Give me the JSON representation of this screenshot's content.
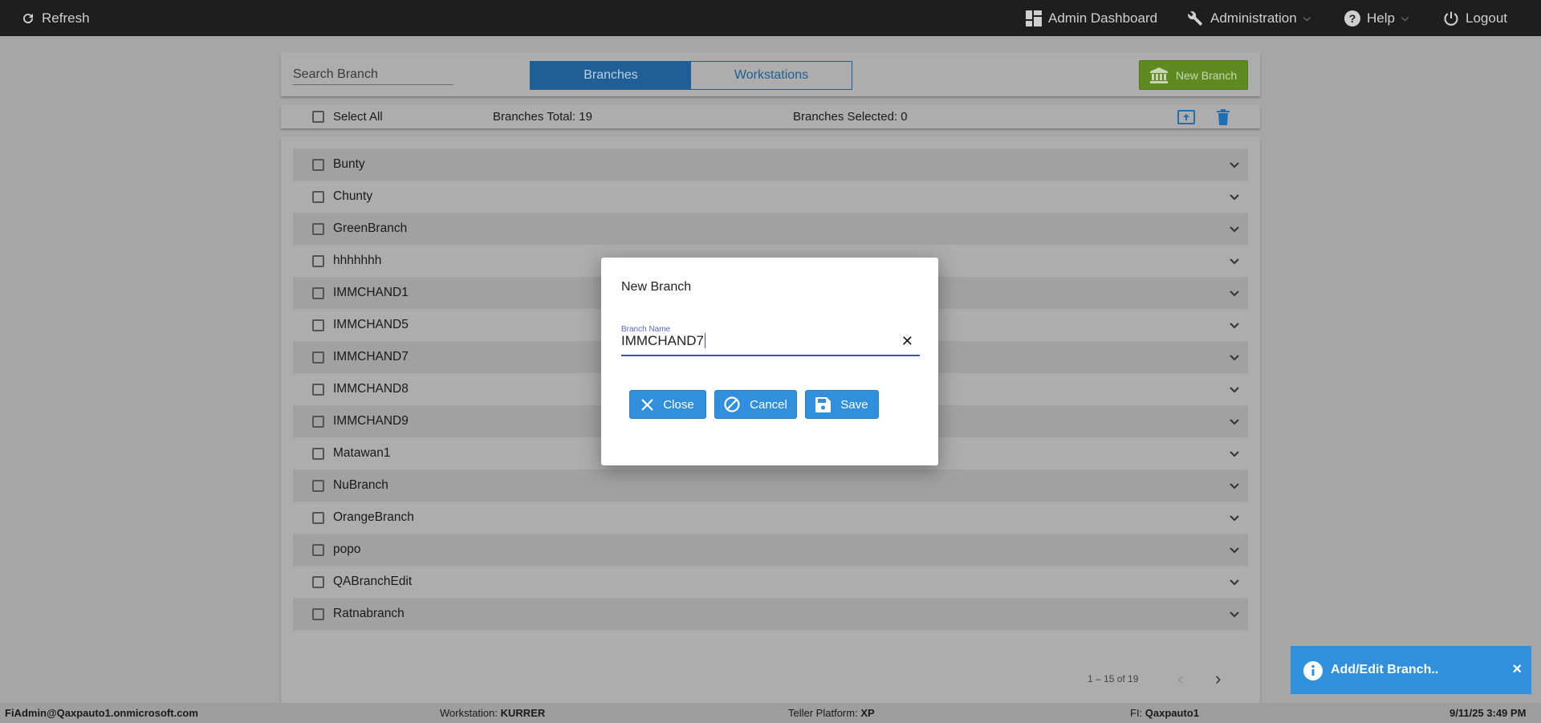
{
  "topbar": {
    "refresh": "Refresh",
    "admin_dashboard": "Admin Dashboard",
    "administration": "Administration",
    "help": "Help",
    "logout": "Logout"
  },
  "header": {
    "search_placeholder": "Search Branch",
    "tabs": [
      {
        "label": "Branches",
        "active": true
      },
      {
        "label": "Workstations",
        "active": false
      }
    ],
    "new_branch": "New Branch"
  },
  "selection": {
    "select_all": "Select All",
    "total": "Branches Total: 19",
    "selected": "Branches Selected: 0"
  },
  "branches": [
    "Bunty",
    "Chunty",
    "GreenBranch",
    "hhhhhhh",
    "IMMCHAND1",
    "IMMCHAND5",
    "IMMCHAND7",
    "IMMCHAND8",
    "IMMCHAND9",
    "Matawan1",
    "NuBranch",
    "OrangeBranch",
    "popo",
    "QABranchEdit",
    "Ratnabranch"
  ],
  "pagination": {
    "range": "1 – 15 of 19"
  },
  "modal": {
    "title": "New Branch",
    "field_label": "Branch Name",
    "field_value": "IMMCHAND7",
    "close": "Close",
    "cancel": "Cancel",
    "save": "Save"
  },
  "toast": {
    "message": "Add/Edit Branch..",
    "close": "×"
  },
  "statusbar": {
    "user": "FiAdmin@Qaxpauto1.onmicrosoft.com",
    "workstation_label": "Workstation:",
    "workstation": "KURRER",
    "platform_label": "Teller Platform:",
    "platform": "XP",
    "fi_label": "FI:",
    "fi": "Qaxpauto1",
    "datetime": "9/11/25 3:49 PM"
  },
  "colors": {
    "topbar": "#1e1e1e",
    "tab_active": "#1f5f96",
    "new_branch": "#5f8a22",
    "primary": "#3090dd"
  }
}
